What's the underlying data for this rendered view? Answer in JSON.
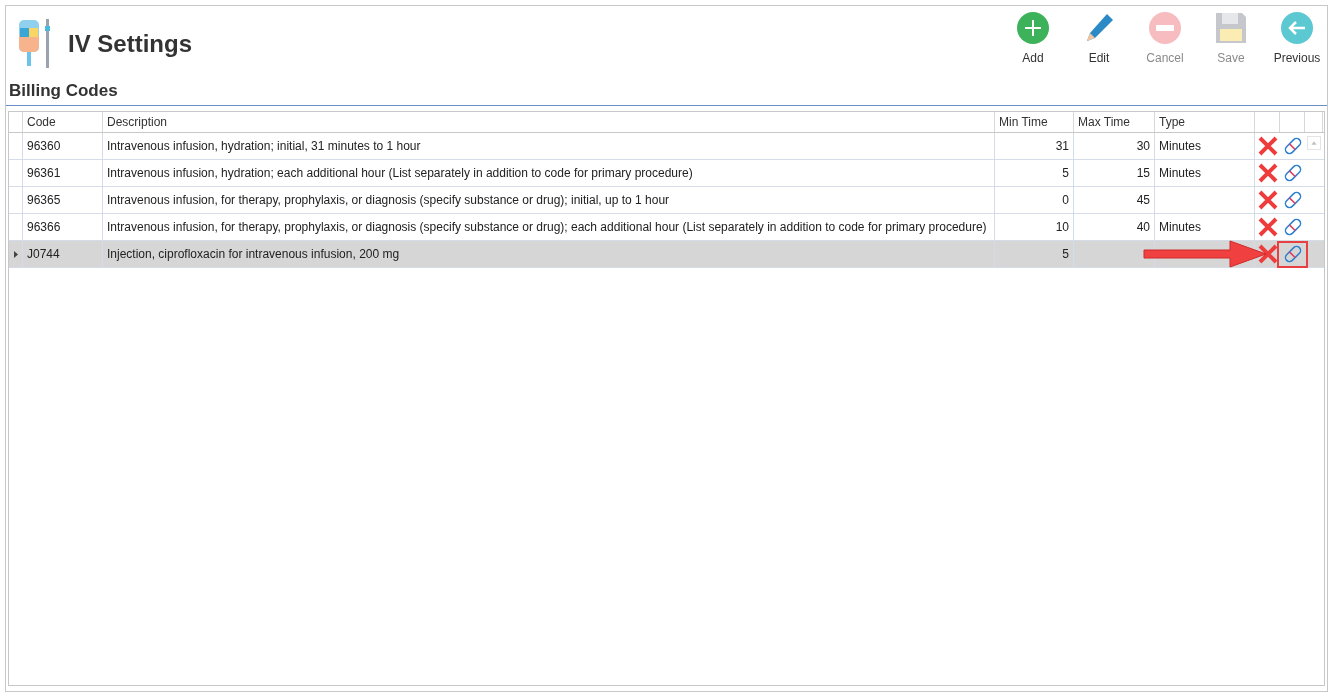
{
  "header": {
    "title": "IV Settings"
  },
  "toolbar": [
    {
      "kind": "add",
      "label": "Add",
      "disabled": false
    },
    {
      "kind": "edit",
      "label": "Edit",
      "disabled": false
    },
    {
      "kind": "cancel",
      "label": "Cancel",
      "disabled": true
    },
    {
      "kind": "save",
      "label": "Save",
      "disabled": true
    },
    {
      "kind": "previous",
      "label": "Previous",
      "disabled": false
    }
  ],
  "section_title": "Billing Codes",
  "table": {
    "columns": [
      "Code",
      "Description",
      "Min Time",
      "Max Time",
      "Type"
    ],
    "rows": [
      {
        "code": "96360",
        "description": "Intravenous infusion, hydration; initial, 31 minutes to 1 hour",
        "min_time": "31",
        "max_time": "30",
        "type": "Minutes",
        "selected": false,
        "annotated": false
      },
      {
        "code": "96361",
        "description": "Intravenous infusion, hydration; each additional hour (List separately in addition to code for primary procedure)",
        "min_time": "5",
        "max_time": "15",
        "type": "Minutes",
        "selected": false,
        "annotated": false
      },
      {
        "code": "96365",
        "description": "Intravenous infusion, for therapy, prophylaxis, or diagnosis (specify substance or drug); initial, up to 1 hour",
        "min_time": "0",
        "max_time": "45",
        "selected": false,
        "annotated": false
      },
      {
        "code": "96366",
        "description": "Intravenous infusion, for therapy, prophylaxis, or diagnosis (specify substance or drug); each additional hour (List separately in addition to code for primary procedure)",
        "min_time": "10",
        "max_time": "40",
        "type": "Minutes",
        "selected": false,
        "annotated": false
      },
      {
        "code": "J0744",
        "description": "Injection, ciprofloxacin for intravenous infusion, 200 mg",
        "min_time": "5",
        "selected": true,
        "annotated": true
      }
    ]
  }
}
